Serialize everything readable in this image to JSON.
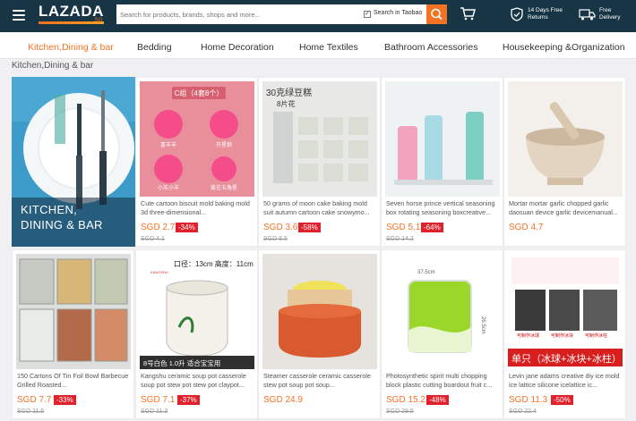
{
  "header": {
    "logo": "LAZADA",
    "logo_region": ".SG",
    "search_placeholder": "Search for products, brands, shops and more...",
    "search_taobao": "Search in Taobao",
    "returns": "14 Days Free\nReturns",
    "delivery": "Free\nDelivery"
  },
  "categories": [
    "Kitchen,Dining & bar",
    "Bedding",
    "Home Decoration",
    "Home Textiles",
    "Bathroom Accessories",
    "Housekeeping &Organization"
  ],
  "breadcrumb": "Kitchen,Dining & bar",
  "hero_label": "KITCHEN,\nDINING & BAR",
  "products": [
    {
      "title": "Cute cartoon biscuit mold baking mold 3d three-dimensional...",
      "price": "SGD 2.7",
      "discount": "-34%",
      "old": "SGD 4.1",
      "img_text_1": "C组（4套8个）",
      "img_text_2": "喜羊羊",
      "img_text_3": "开星狼",
      "img_text_4": "小灰小羊",
      "img_text_5": "爱在五角星"
    },
    {
      "title": "50 grams of moon cake baking mold suit autumn cartoon cake snowymo...",
      "price": "SGD 3.6",
      "discount": "-58%",
      "old": "SGD 8.5",
      "img_text_1": "30克绿豆糕",
      "img_text_2": "8片花"
    },
    {
      "title": "Seven horse prince vertical seasoning box rotating seasoning boxcreative...",
      "price": "SGD 5.1",
      "discount": "-64%",
      "old": "SGD 14.2"
    },
    {
      "title": "Mortar mortar garlic chopped garlic daosuan device garlic devicemanual...",
      "price": "SGD 4.7",
      "discount": "",
      "old": ""
    },
    {
      "title": "150 Cartons Of Tin Foil Bowl Barbecue Grilled Roasted...",
      "price": "SGD 7.7",
      "discount": "-33%",
      "old": "SGD 11.5"
    },
    {
      "title": "Kangshu ceramic soup pot casserole soup pot stew pot stew pot claypot...",
      "price": "SGD 7.1",
      "discount": "-37%",
      "old": "SGD 11.3",
      "img_text_1": "口径：13cm  高度：11cm",
      "img_text_2": "8号白色  1.0升  适合宝宝用",
      "img_text_3": "KANGSHU"
    },
    {
      "title": "Steamer casserole ceramic casserole stew pot soup pot soup...",
      "price": "SGD 24.9",
      "discount": "",
      "old": ""
    },
    {
      "title": "Photosynthetic spirit multi chopping block plastic cutting boardout fruit c...",
      "price": "SGD 15.2",
      "discount": "-48%",
      "old": "SGD 29.5",
      "img_text_1": "37.5cm",
      "img_text_2": "26.5cm"
    },
    {
      "title": "Levin jane adams creative diy ice mold ice lattice silicone icelattice ic...",
      "price": "SGD 11.3",
      "discount": "-50%",
      "old": "SGD 22.4",
      "img_text_1": "单只（冰球+冰块+冰柱）",
      "img_text_2": "可制作冰球",
      "img_text_3": "可制作冰块",
      "img_text_4": "可制作冰柱"
    }
  ],
  "colors": {
    "topbar": "#183545",
    "accent": "#f57224",
    "discount": "#e0202a"
  }
}
